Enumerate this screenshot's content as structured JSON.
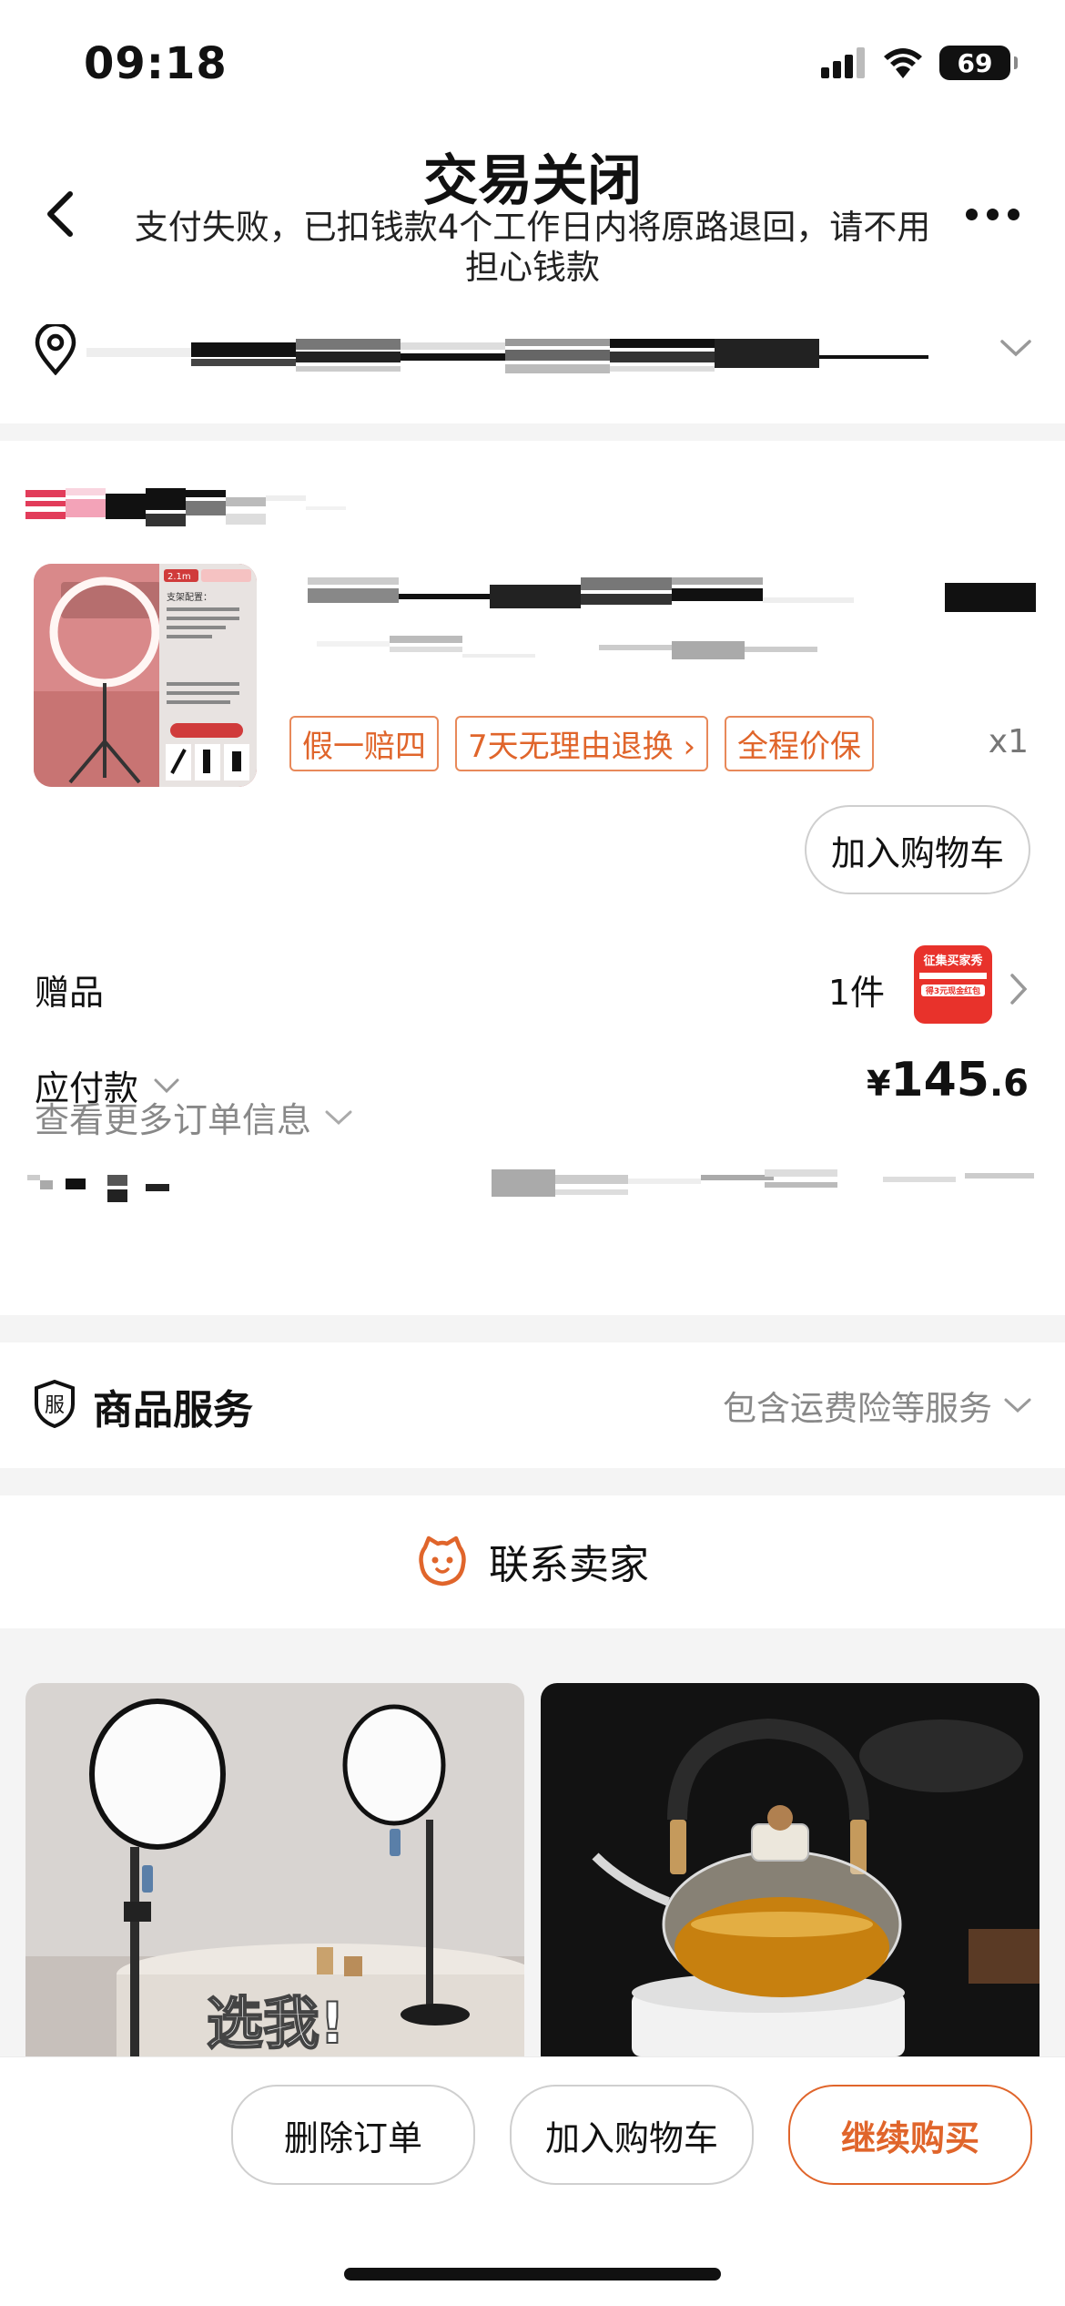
{
  "status_bar": {
    "time": "09:18",
    "battery": "69"
  },
  "header": {
    "title": "交易关闭",
    "subtitle": "支付失败，已扣钱款4个工作日内将原路退回，请不用担心钱款"
  },
  "order": {
    "thumb_texts": [
      "2.1m",
      "支架配置："
    ],
    "tags": [
      "假一赔四",
      "7天无理由退换 ›",
      "全程价保"
    ],
    "quantity": "x1",
    "add_to_cart": "加入购物车",
    "gift_label": "赠品",
    "gift_count": "1件",
    "gift_thumb_texts": [
      "征集买家秀",
      "得3元现金红包"
    ],
    "payable_label": "应付款",
    "price_symbol": "¥",
    "price_int": "145",
    "price_dec": ".6",
    "more_info": "查看更多订单信息"
  },
  "service": {
    "icon_char": "服",
    "title": "商品服务",
    "note": "包含运费险等服务"
  },
  "contact": {
    "label": "联系卖家"
  },
  "recommend": {
    "card1_text": "选我!"
  },
  "actions": {
    "delete": "删除订单",
    "add_cart": "加入购物车",
    "buy_again": "继续购买"
  },
  "colors": {
    "accent": "#e0652b",
    "tag_border": "#e8895a",
    "gift_red": "#e8322b"
  }
}
